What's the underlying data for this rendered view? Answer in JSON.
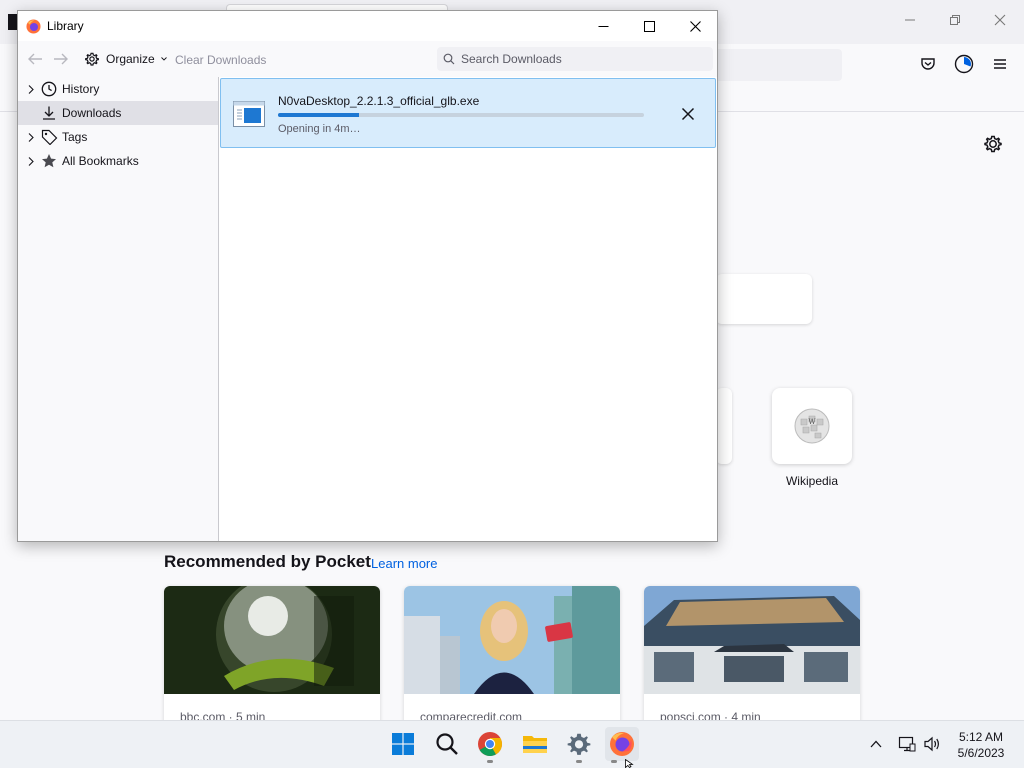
{
  "browser": {
    "toolbar_icons": [
      "pocket-icon",
      "account-icon",
      "menu-icon"
    ],
    "new_tab": {
      "shortcut_label": "Wikipedia",
      "pocket_heading": "Recommended by Pocket",
      "pocket_learn_more": "Learn more",
      "pocket_cards": [
        {
          "source": "bbc.com · 5 min"
        },
        {
          "source": "comparecredit.com"
        },
        {
          "source": "popsci.com · 4 min"
        }
      ]
    }
  },
  "library": {
    "title": "Library",
    "organize_label": "Organize",
    "clear_downloads_label": "Clear Downloads",
    "search_placeholder": "Search Downloads",
    "sidebar": [
      {
        "label": "History",
        "icon": "clock-icon",
        "expandable": true,
        "selected": false
      },
      {
        "label": "Downloads",
        "icon": "download-icon",
        "expandable": false,
        "selected": true
      },
      {
        "label": "Tags",
        "icon": "tag-icon",
        "expandable": true,
        "selected": false
      },
      {
        "label": "All Bookmarks",
        "icon": "star-icon",
        "expandable": true,
        "selected": false
      }
    ],
    "download": {
      "filename": "N0vaDesktop_2.2.1.3_official_glb.exe",
      "status": "Opening in 4m…",
      "progress": 0.22
    }
  },
  "taskbar": {
    "apps": [
      "windows-start",
      "search",
      "chrome",
      "file-explorer",
      "settings",
      "firefox"
    ],
    "time": "5:12 AM",
    "date": "5/6/2023"
  },
  "colors": {
    "accent": "#0061e0",
    "download_highlight": "#d8ecfc",
    "progress": "#1e78d2"
  }
}
